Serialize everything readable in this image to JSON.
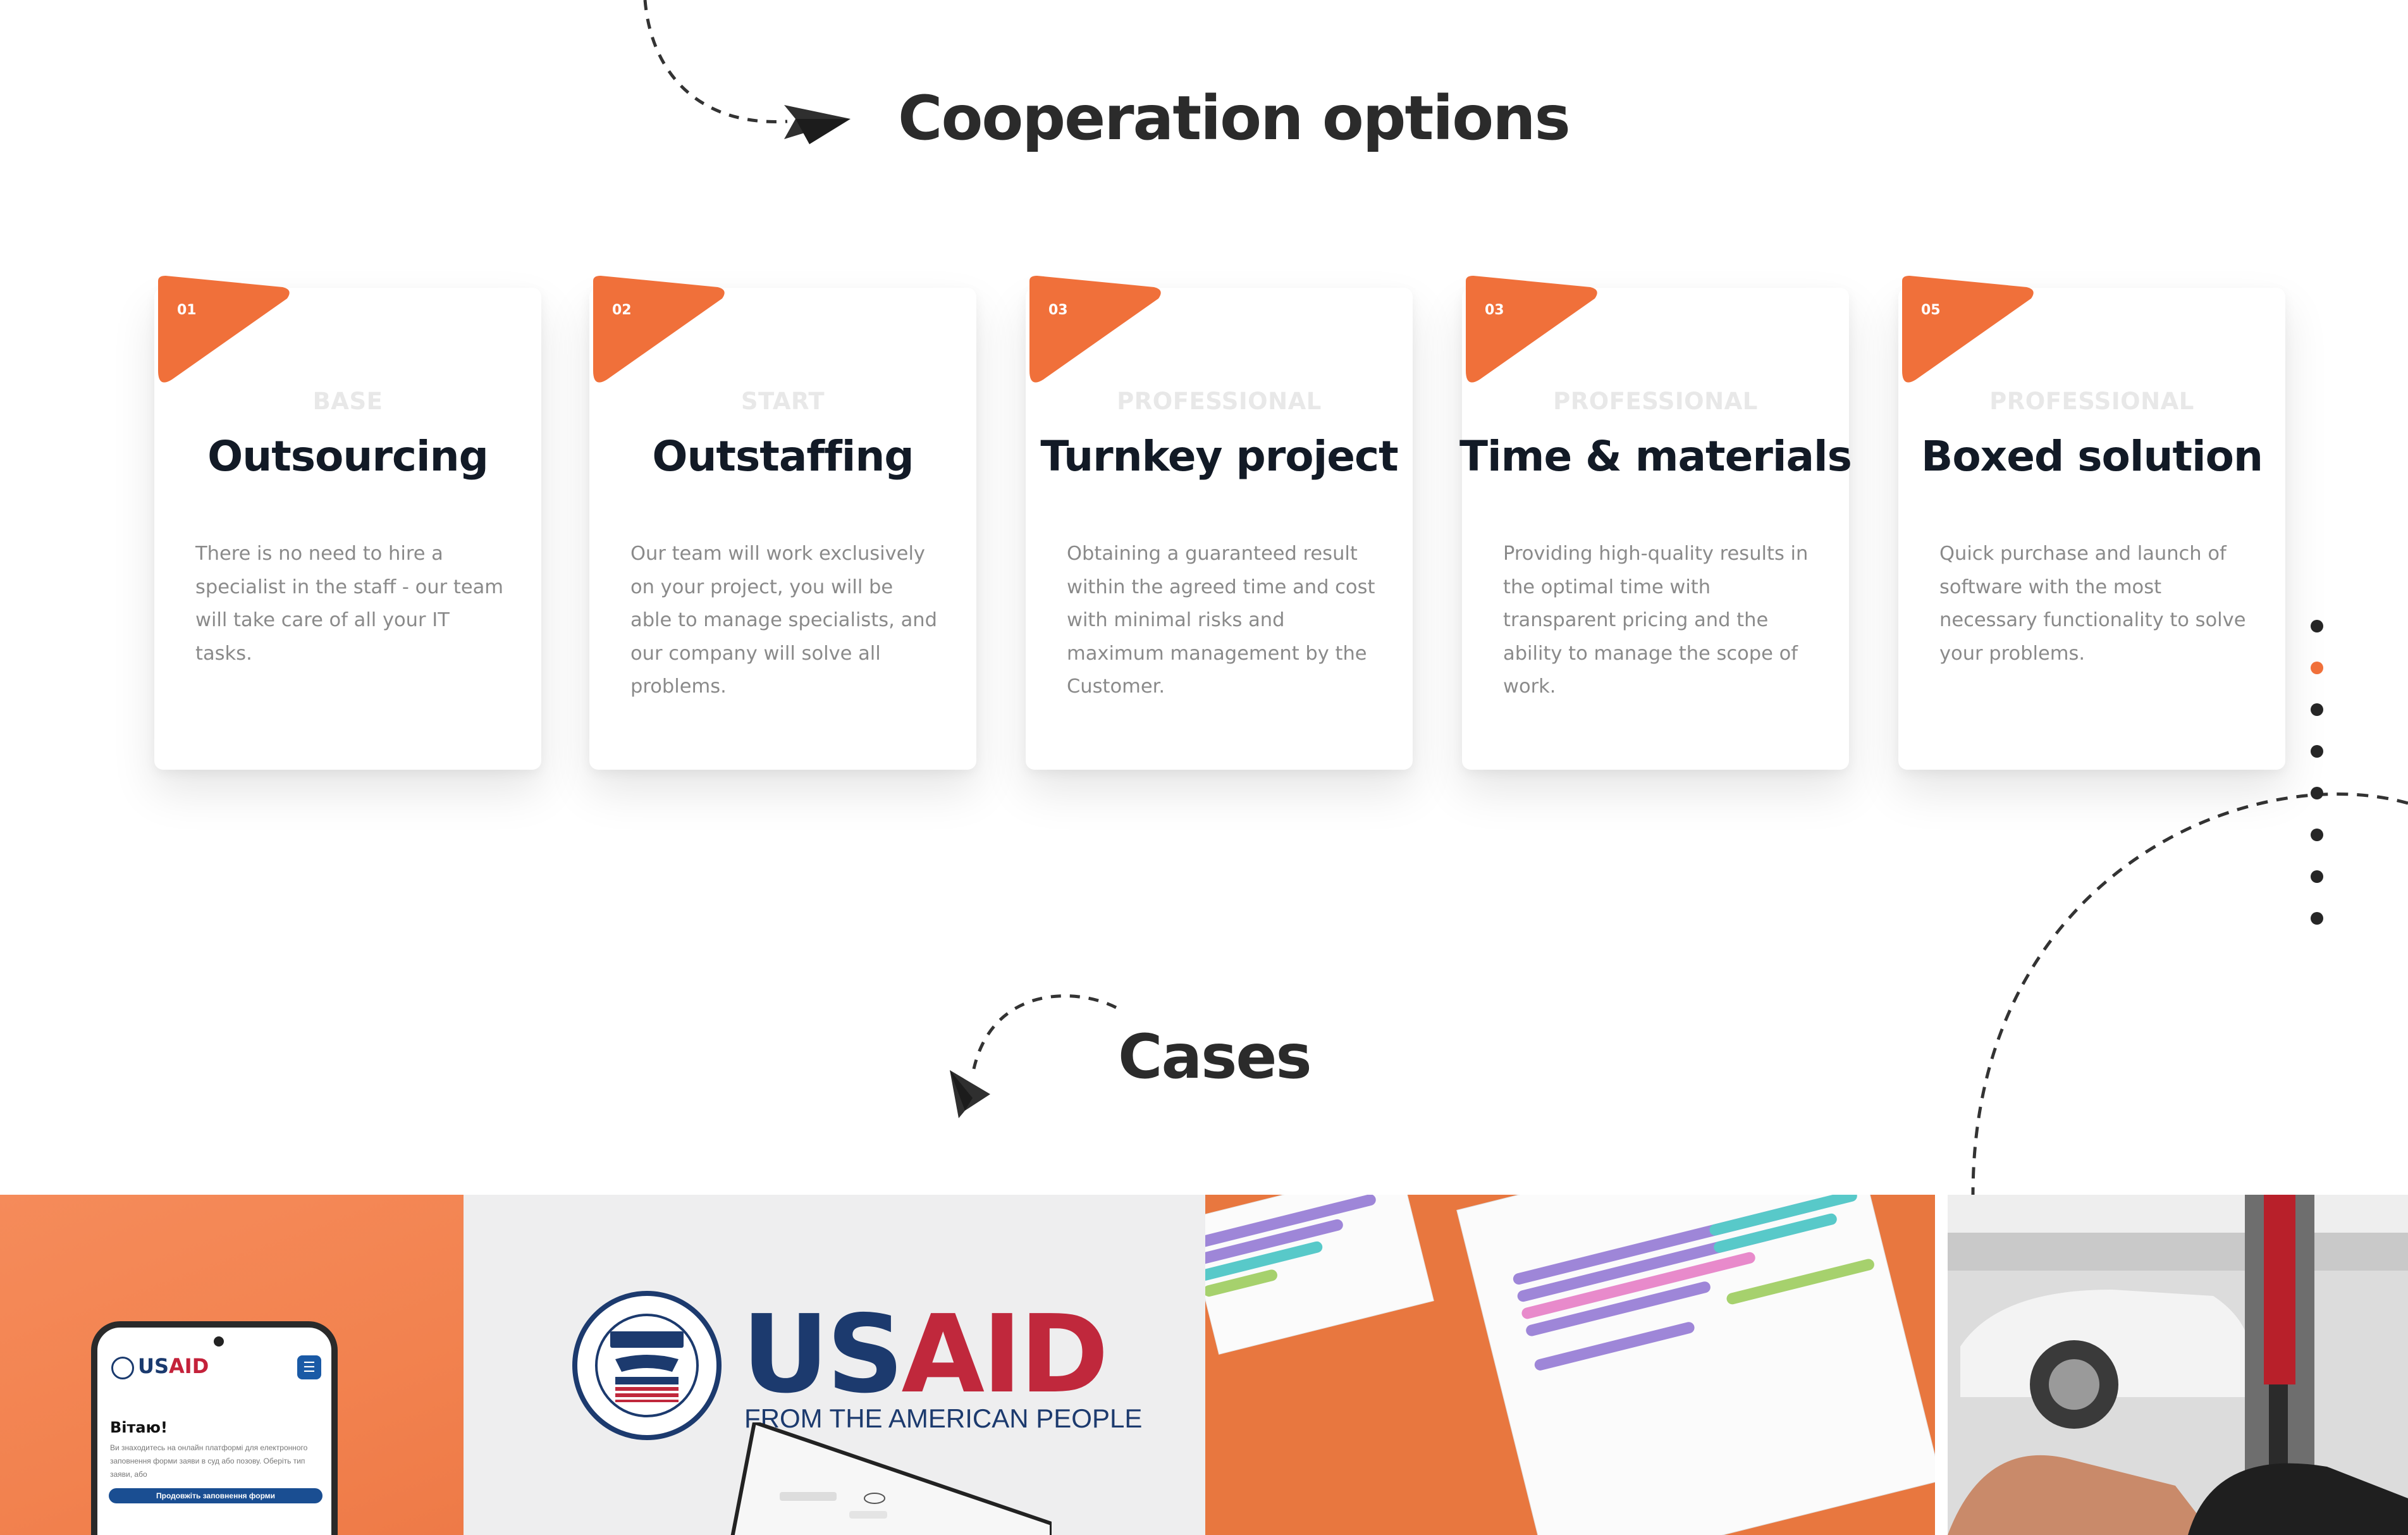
{
  "sections": {
    "cooperation_title": "Cooperation options",
    "cases_title": "Cases"
  },
  "cards": [
    {
      "num": "01",
      "tier": "BASE",
      "title": "Outsourcing",
      "desc": "There is no need to hire a specialist in the staff - our team will take care of all your IT tasks."
    },
    {
      "num": "02",
      "tier": "START",
      "title": "Outstaffing",
      "desc": "Our team will work exclusively on your project, you will be able to manage specialists, and our company will solve all problems."
    },
    {
      "num": "03",
      "tier": "PROFESSIONAL",
      "title": "Turnkey project",
      "desc": "Obtaining a guaranteed result within the agreed time and cost with minimal risks and maximum management by the Customer."
    },
    {
      "num": "03",
      "tier": "PROFESSIONAL",
      "title": "Time & materials",
      "desc": "Providing high-quality results in the optimal time with transparent pricing and the ability to manage the scope of work."
    },
    {
      "num": "05",
      "tier": "PROFESSIONAL",
      "title": "Boxed solution",
      "desc": "Quick purchase and launch of software with the most necessary functionality to solve your problems."
    }
  ],
  "pager": {
    "count": 8,
    "active_index": 1
  },
  "cases": {
    "phone": {
      "logo_a": "US",
      "logo_b": "AID",
      "greeting": "Вітаю!",
      "text": "Ви знаходитесь на онлайн платформі для електронного заповнення форми заяви в суд або позову. Оберіть тип заяви, або",
      "button": "Продовжіть заповнення форми"
    },
    "usaid": {
      "word_a": "US",
      "word_b": "AID",
      "tagline": "FROM THE AMERICAN PEOPLE"
    }
  },
  "colors": {
    "accent": "#f0703a",
    "title": "#2b2b2b",
    "card_title": "#121a26",
    "tier": "#e8e8e8",
    "desc": "#8a8a8a"
  }
}
